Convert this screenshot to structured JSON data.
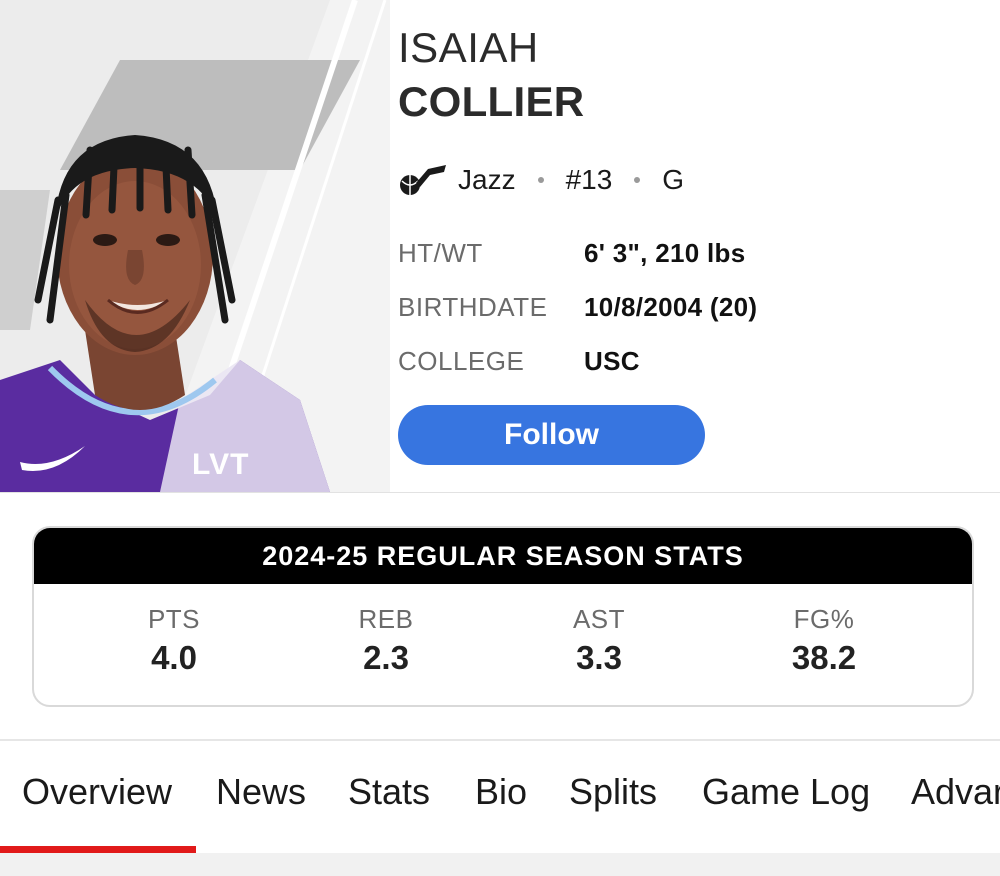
{
  "player": {
    "first_name": "ISAIAH",
    "last_name": "COLLIER",
    "team": "Jazz",
    "number": "#13",
    "position": "G",
    "jersey_text": "LVT"
  },
  "info": [
    {
      "label": "HT/WT",
      "value": "6' 3\", 210 lbs"
    },
    {
      "label": "BIRTHDATE",
      "value": "10/8/2004 (20)"
    },
    {
      "label": "COLLEGE",
      "value": "USC"
    }
  ],
  "follow_label": "Follow",
  "stats": {
    "title": "2024-25 REGULAR SEASON STATS",
    "items": [
      {
        "label": "PTS",
        "value": "4.0"
      },
      {
        "label": "REB",
        "value": "2.3"
      },
      {
        "label": "AST",
        "value": "3.3"
      },
      {
        "label": "FG%",
        "value": "38.2"
      }
    ]
  },
  "tabs": [
    "Overview",
    "News",
    "Stats",
    "Bio",
    "Splits",
    "Game Log",
    "Advar"
  ],
  "active_tab": "Overview",
  "colors": {
    "follow_button": "#3775e0",
    "active_tab_indicator": "#e11a1a",
    "jersey_purple": "#5a2ca0"
  },
  "icons": [
    "jazz-team-logo-icon",
    "player-headshot"
  ]
}
